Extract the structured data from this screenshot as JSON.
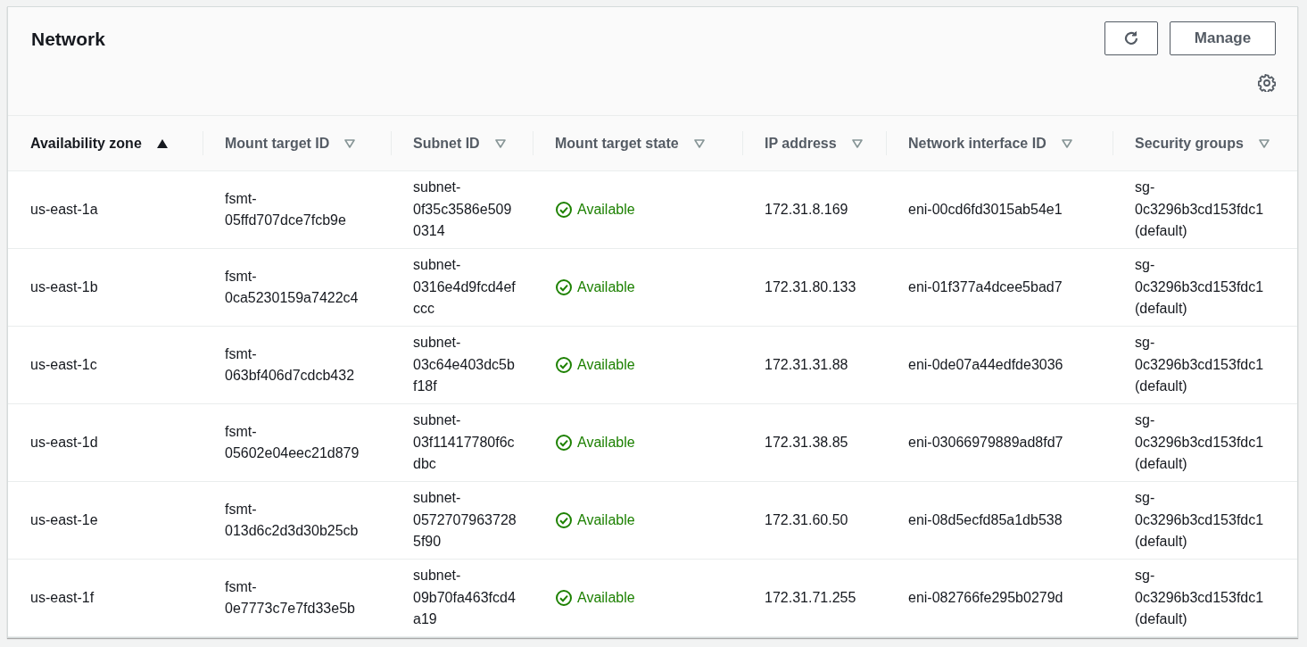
{
  "panel": {
    "title": "Network",
    "buttons": [
      {
        "kind": "refresh"
      },
      {
        "kind": "text",
        "label": "Manage"
      }
    ]
  },
  "table": {
    "columns": [
      {
        "label": "Availability zone",
        "sorted": true
      },
      {
        "label": "Mount target ID",
        "sorted": false
      },
      {
        "label": "Subnet ID",
        "sorted": false
      },
      {
        "label": "Mount target state",
        "sorted": false
      },
      {
        "label": "IP address",
        "sorted": false
      },
      {
        "label": "Network interface ID",
        "sorted": false
      },
      {
        "label": "Security groups",
        "sorted": false
      }
    ],
    "rows": [
      {
        "zone": "us-east-1a",
        "mount_target_id": "fsmt-05ffd707dce7fcb9e",
        "subnet_id": "subnet-0f35c3586e5090314",
        "state": {
          "kind": "success",
          "label": "Available"
        },
        "ip": "172.31.8.169",
        "eni": "eni-00cd6fd3015ab54e1",
        "security_groups": "sg-0c3296b3cd153fdc1 (default)"
      },
      {
        "zone": "us-east-1b",
        "mount_target_id": "fsmt-0ca5230159a7422c4",
        "subnet_id": "subnet-0316e4d9fcd4efccc",
        "state": {
          "kind": "success",
          "label": "Available"
        },
        "ip": "172.31.80.133",
        "eni": "eni-01f377a4dcee5bad7",
        "security_groups": "sg-0c3296b3cd153fdc1 (default)"
      },
      {
        "zone": "us-east-1c",
        "mount_target_id": "fsmt-063bf406d7cdcb432",
        "subnet_id": "subnet-03c64e403dc5bf18f",
        "state": {
          "kind": "success",
          "label": "Available"
        },
        "ip": "172.31.31.88",
        "eni": "eni-0de07a44edfde3036",
        "security_groups": "sg-0c3296b3cd153fdc1 (default)"
      },
      {
        "zone": "us-east-1d",
        "mount_target_id": "fsmt-05602e04eec21d879",
        "subnet_id": "subnet-03f11417780f6cdbc",
        "state": {
          "kind": "success",
          "label": "Available"
        },
        "ip": "172.31.38.85",
        "eni": "eni-03066979889ad8fd7",
        "security_groups": "sg-0c3296b3cd153fdc1 (default)"
      },
      {
        "zone": "us-east-1e",
        "mount_target_id": "fsmt-013d6c2d3d30b25cb",
        "subnet_id": "subnet-05727079637285f90",
        "state": {
          "kind": "success",
          "label": "Available"
        },
        "ip": "172.31.60.50",
        "eni": "eni-08d5ecfd85a1db538",
        "security_groups": "sg-0c3296b3cd153fdc1 (default)"
      },
      {
        "zone": "us-east-1f",
        "mount_target_id": "fsmt-0e7773c7e7fd33e5b",
        "subnet_id": "subnet-09b70fa463fcd4a19",
        "state": {
          "kind": "success",
          "label": "Available"
        },
        "ip": "172.31.71.255",
        "eni": "eni-082766fe295b0279d",
        "security_groups": "sg-0c3296b3cd153fdc1 (default)"
      }
    ]
  }
}
